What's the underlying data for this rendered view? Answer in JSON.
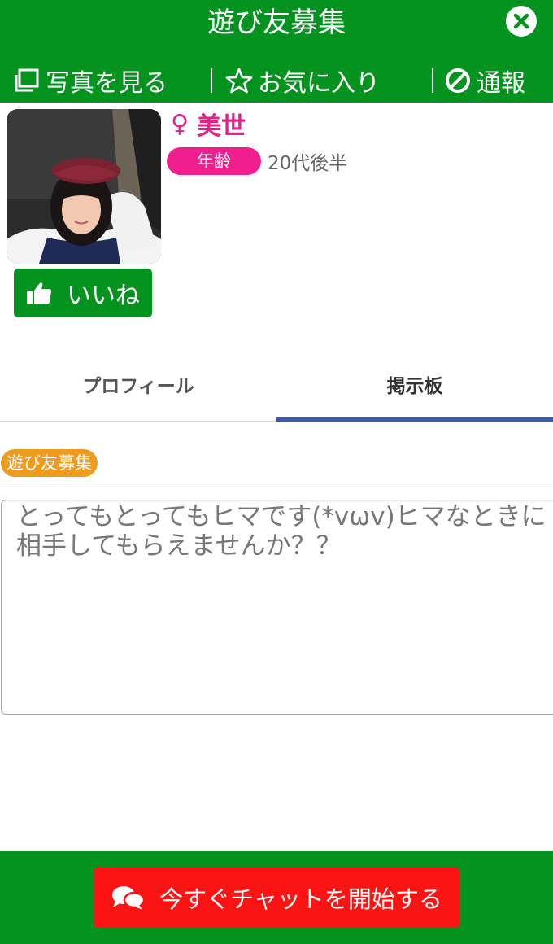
{
  "header": {
    "title": "遊び友募集",
    "actions": {
      "photos": "写真を見る",
      "favorite": "お気に入り",
      "report": "通報"
    }
  },
  "profile": {
    "gender_symbol": "♀",
    "name": "美世",
    "age_label": "年齢",
    "age_value": "20代後半",
    "like_label": "いいね"
  },
  "tabs": {
    "profile": "プロフィール",
    "board": "掲示板"
  },
  "post": {
    "category": "遊び友募集",
    "message": "とってもとってもヒマです(*vωv)ヒマなときに相手してもらえませんか？？"
  },
  "footer": {
    "chat_button": "今すぐチャットを開始する"
  },
  "colors": {
    "brand_green": "#059320",
    "accent_pink": "#f01e8e",
    "badge_orange": "#ef9b1d",
    "cta_red": "#fc1313",
    "tab_underline": "#3a58b8"
  }
}
